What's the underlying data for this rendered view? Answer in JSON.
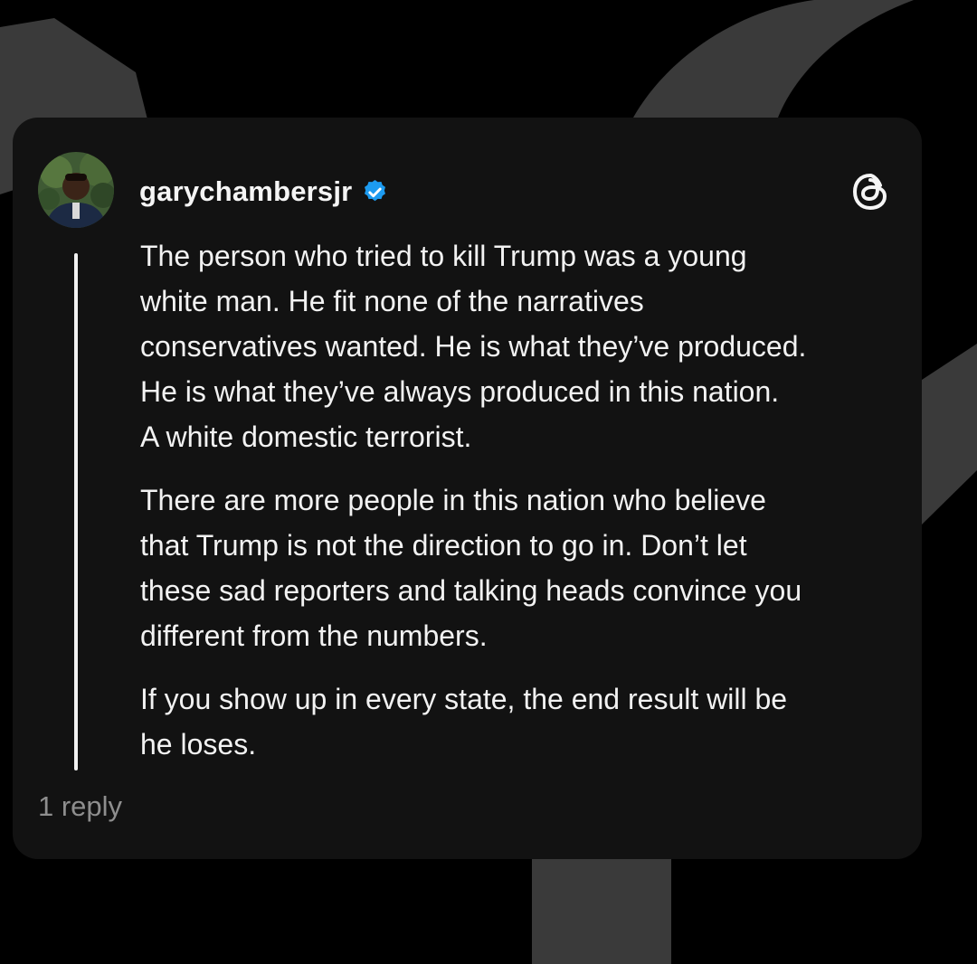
{
  "post": {
    "username": "garychambersjr",
    "verified": true,
    "paragraphs": [
      "The person who tried to kill Trump was a young\nwhite man. He fit none of the narratives\nconservatives wanted. He is what they’ve produced.\nHe is what they’ve always produced in this nation.\nA white domestic terrorist.",
      "There are more people in this nation who believe\nthat Trump is not the direction to go in. Don’t let\nthese sad reporters and talking heads convince you\ndifferent from the numbers.",
      "If you show up in every state, the end result will be\nhe loses."
    ],
    "reply_count": "1 reply"
  },
  "icons": {
    "verified": "verified-badge-icon",
    "platform": "threads-logo-icon"
  },
  "colors": {
    "background": "#000000",
    "card": "#121212",
    "text": "#f2f2f2",
    "muted": "#8e8e8e",
    "verified": "#1d9bf0"
  }
}
